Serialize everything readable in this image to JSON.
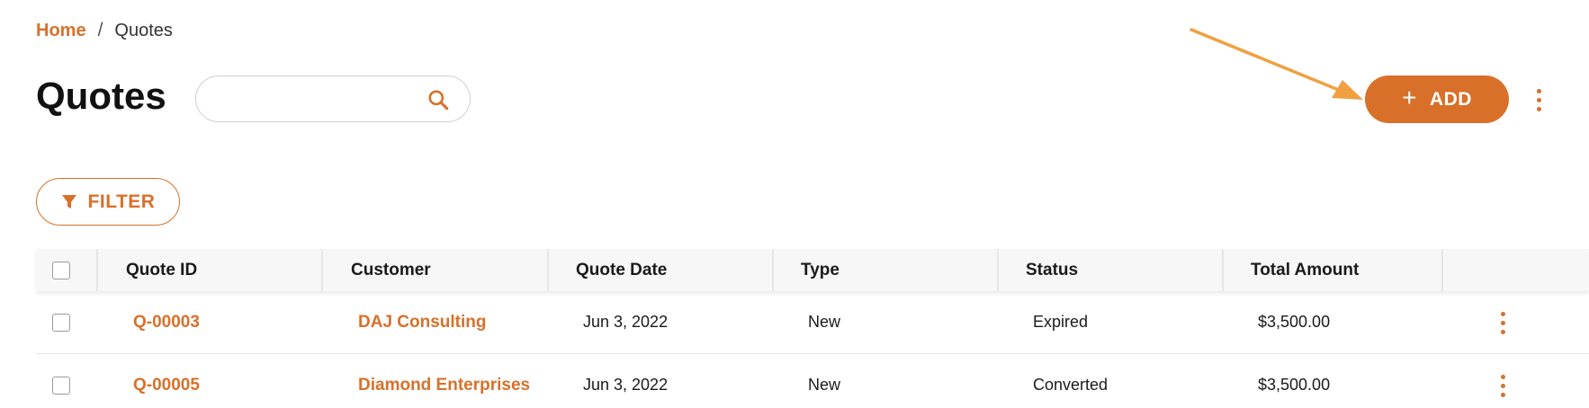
{
  "breadcrumb": {
    "home": "Home",
    "separator": "/",
    "current": "Quotes"
  },
  "page": {
    "title": "Quotes"
  },
  "search": {
    "value": "",
    "placeholder": "",
    "icon": "search-icon"
  },
  "toolbar": {
    "add_label": "ADD",
    "add_icon": "plus-icon",
    "more_icon": "more-vertical-icon"
  },
  "filter": {
    "label": "FILTER",
    "icon": "filter-icon"
  },
  "table": {
    "columns": [
      "Quote ID",
      "Customer",
      "Quote Date",
      "Type",
      "Status",
      "Total Amount"
    ],
    "rows": [
      {
        "quote_id": "Q-00003",
        "customer": "DAJ Consulting",
        "quote_date": "Jun 3, 2022",
        "type": "New",
        "status": "Expired",
        "total_amount": "$3,500.00"
      },
      {
        "quote_id": "Q-00005",
        "customer": "Diamond Enterprises",
        "quote_date": "Jun 3, 2022",
        "type": "New",
        "status": "Converted",
        "total_amount": "$3,500.00"
      }
    ]
  },
  "colors": {
    "accent": "#d9702a",
    "arrow": "#f0a040",
    "header_bg": "#f7f7f8"
  }
}
